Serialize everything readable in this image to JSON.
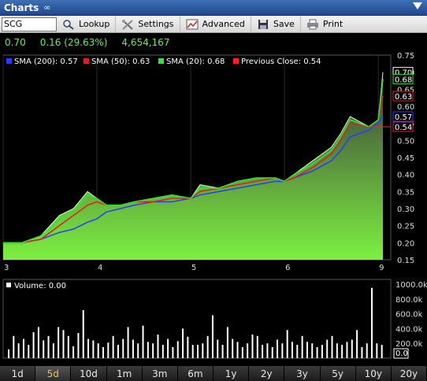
{
  "window": {
    "title": "Charts",
    "link_icon": "link-icon",
    "collapse_icon": "collapse-icon"
  },
  "toolbar": {
    "symbol_value": "SCG",
    "lookup_label": "Lookup",
    "settings_label": "Settings",
    "advanced_label": "Advanced",
    "save_label": "Save",
    "print_label": "Print"
  },
  "quote": {
    "last": "0.70",
    "change": "0.16 (29.63%)",
    "volume": "4,654,167"
  },
  "legend": {
    "sma200": "SMA (200): 0.57",
    "sma50": "SMA (50): 0.63",
    "sma20": "SMA (20): 0.68",
    "prev_close": "Previous Close: 0.54"
  },
  "volume_legend": "Volume: 0.00",
  "colors": {
    "sma200": "#2a3cff",
    "sma50": "#e02020",
    "sma20": "#38e038",
    "prev_close": "#ff2020",
    "price_top": "#3a3a3a",
    "price_bottom": "#7cf040",
    "accent_tab": "#e8c35a"
  },
  "price_axis": {
    "ticks": [
      "0.75",
      "0.70",
      "0.65",
      "0.60",
      "0.55",
      "0.50",
      "0.45",
      "0.40",
      "0.35",
      "0.30",
      "0.25",
      "0.20",
      "0.15"
    ],
    "range": [
      0.15,
      0.75
    ]
  },
  "price_markers": [
    {
      "label": "0.70",
      "value": 0.7,
      "color": "#ffffff"
    },
    {
      "label": "0.68",
      "value": 0.68,
      "color": "#38e038"
    },
    {
      "label": "0.63",
      "value": 0.63,
      "color": "#e02020"
    },
    {
      "label": "0.57",
      "value": 0.57,
      "color": "#2a3cff"
    },
    {
      "label": "0.54",
      "value": 0.54,
      "color": "#e02020"
    }
  ],
  "volume_axis": {
    "ticks": [
      "1000.0k",
      "800.0k",
      "600.0k",
      "400.0k",
      "200.0k"
    ],
    "range": [
      0,
      1000
    ],
    "last_label": "0.0"
  },
  "x_labels": [
    {
      "label": "3",
      "x": 0.0
    },
    {
      "label": "4",
      "x": 1.0
    },
    {
      "label": "5",
      "x": 2.0
    },
    {
      "label": "6",
      "x": 3.0
    },
    {
      "label": "9",
      "x": 4.0
    }
  ],
  "chart_data": {
    "type": "area",
    "x": [
      0.0,
      0.2,
      0.4,
      0.5,
      0.6,
      0.75,
      0.9,
      1.0,
      1.1,
      1.25,
      1.4,
      1.6,
      1.8,
      2.0,
      2.1,
      2.3,
      2.5,
      2.7,
      2.9,
      3.0,
      3.1,
      3.3,
      3.5,
      3.6,
      3.7,
      3.9,
      4.0,
      4.05
    ],
    "values": [
      0.2,
      0.2,
      0.22,
      0.25,
      0.28,
      0.3,
      0.35,
      0.33,
      0.31,
      0.31,
      0.32,
      0.33,
      0.34,
      0.33,
      0.37,
      0.36,
      0.38,
      0.39,
      0.39,
      0.38,
      0.4,
      0.44,
      0.48,
      0.52,
      0.57,
      0.54,
      0.56,
      0.7
    ],
    "series": [
      {
        "name": "SMA (200)",
        "values": [
          0.2,
          0.2,
          0.21,
          0.22,
          0.23,
          0.24,
          0.26,
          0.27,
          0.29,
          0.3,
          0.31,
          0.32,
          0.32,
          0.33,
          0.34,
          0.35,
          0.36,
          0.37,
          0.38,
          0.38,
          0.39,
          0.41,
          0.44,
          0.47,
          0.51,
          0.53,
          0.55,
          0.57
        ]
      },
      {
        "name": "SMA (50)",
        "values": [
          0.2,
          0.2,
          0.21,
          0.23,
          0.25,
          0.28,
          0.31,
          0.32,
          0.31,
          0.31,
          0.32,
          0.32,
          0.33,
          0.33,
          0.35,
          0.36,
          0.37,
          0.38,
          0.39,
          0.38,
          0.39,
          0.42,
          0.46,
          0.5,
          0.55,
          0.54,
          0.56,
          0.63
        ]
      },
      {
        "name": "SMA (20)",
        "values": [
          0.2,
          0.2,
          0.22,
          0.24,
          0.27,
          0.29,
          0.34,
          0.33,
          0.31,
          0.31,
          0.32,
          0.33,
          0.34,
          0.33,
          0.36,
          0.36,
          0.38,
          0.39,
          0.39,
          0.38,
          0.4,
          0.43,
          0.47,
          0.51,
          0.56,
          0.54,
          0.56,
          0.68
        ]
      }
    ],
    "previous_close": 0.54,
    "volume": [
      120,
      300,
      200,
      260,
      180,
      350,
      420,
      240,
      300,
      200,
      420,
      380,
      300,
      160,
      340,
      650,
      260,
      240,
      200,
      150,
      210,
      300,
      180,
      260,
      420,
      250,
      200,
      440,
      220,
      200,
      320,
      180,
      260,
      150,
      230,
      400,
      290,
      180,
      180,
      200,
      300,
      580,
      250,
      180,
      420,
      260,
      220,
      150,
      200,
      320,
      300,
      180,
      200,
      150,
      250,
      200,
      380,
      220,
      180,
      300,
      220,
      200,
      150,
      180,
      250,
      300,
      200,
      180,
      220,
      250,
      380,
      150,
      200,
      950,
      200,
      180
    ],
    "xlim": [
      0,
      4.1
    ],
    "ylim": [
      0.15,
      0.75
    ]
  },
  "tabs": [
    {
      "label": "1d",
      "active": false
    },
    {
      "label": "5d",
      "active": true
    },
    {
      "label": "10d",
      "active": false
    },
    {
      "label": "1m",
      "active": false
    },
    {
      "label": "3m",
      "active": false
    },
    {
      "label": "6m",
      "active": false
    },
    {
      "label": "1y",
      "active": false
    },
    {
      "label": "2y",
      "active": false
    },
    {
      "label": "3y",
      "active": false
    },
    {
      "label": "5y",
      "active": false
    },
    {
      "label": "10y",
      "active": false
    },
    {
      "label": "20y",
      "active": false
    }
  ]
}
